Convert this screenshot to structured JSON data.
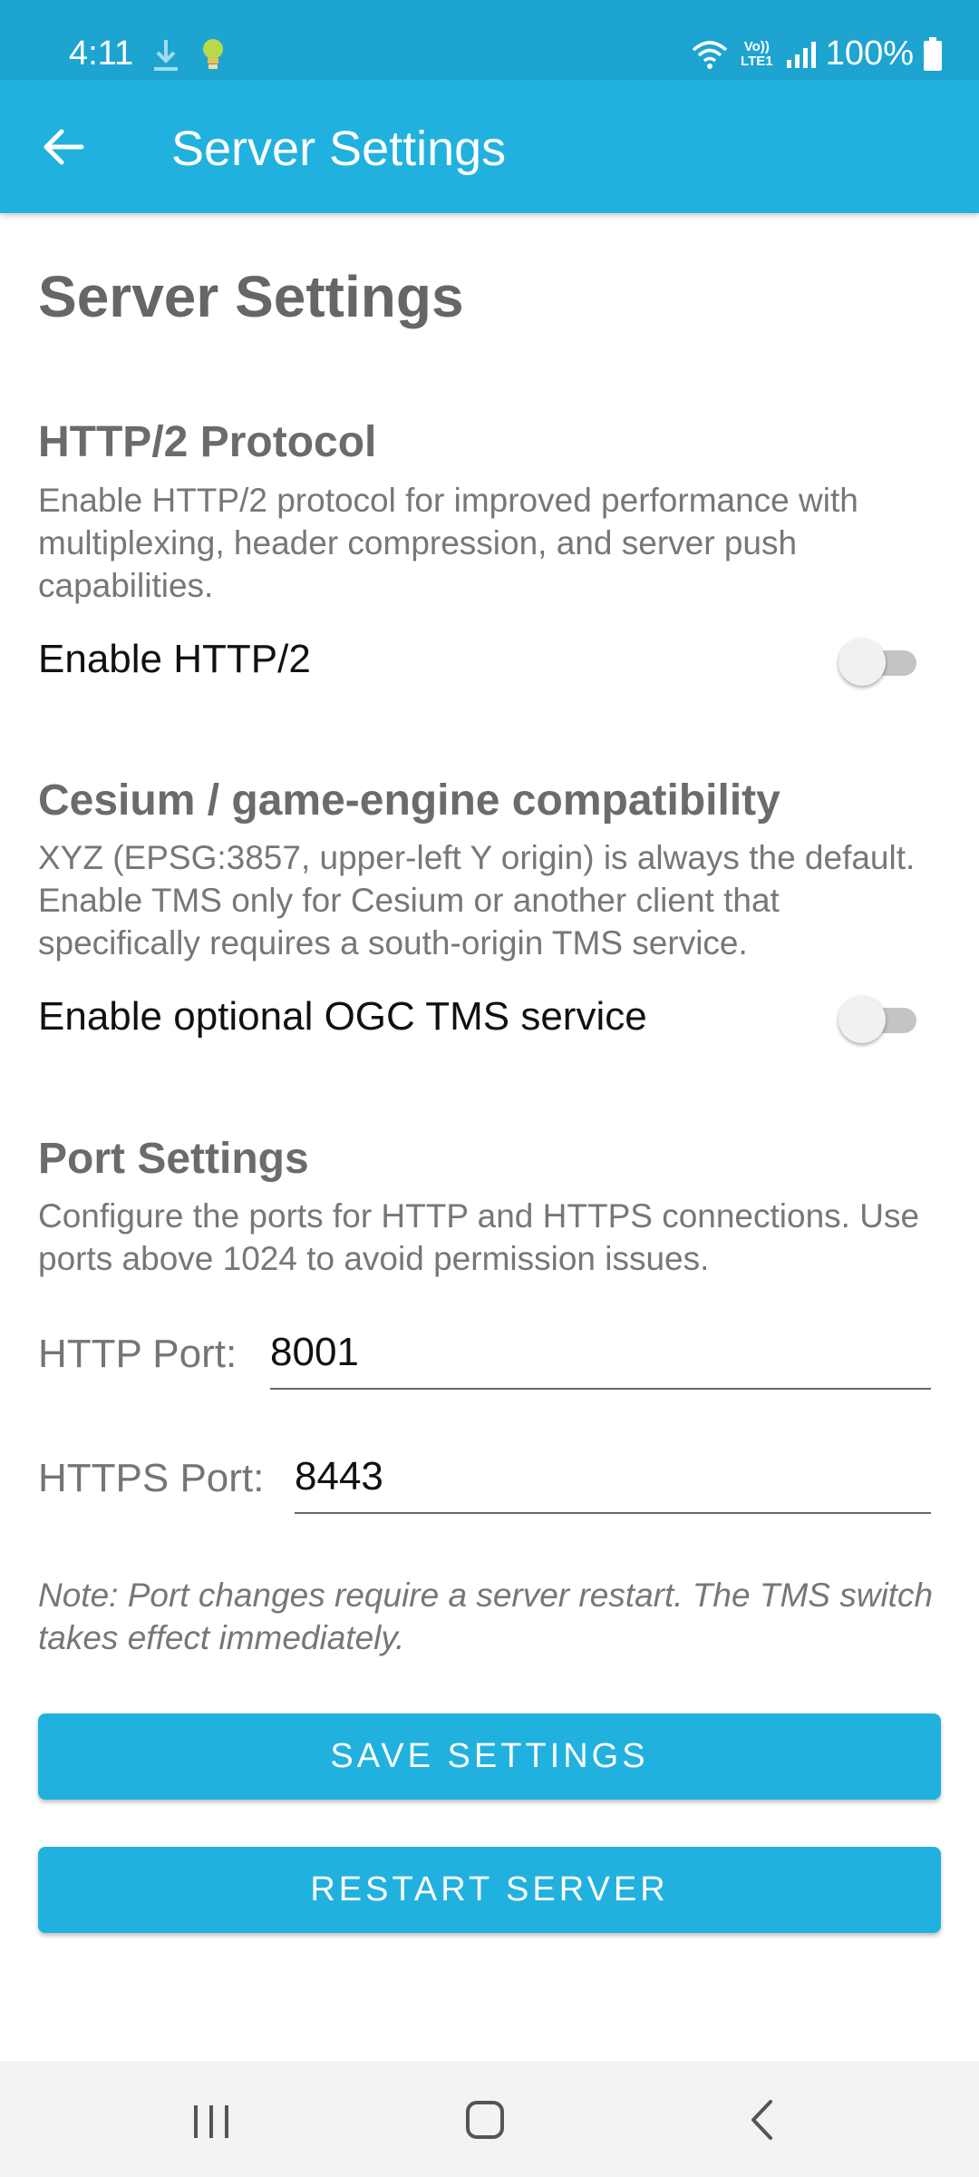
{
  "status_bar": {
    "time": "4:11",
    "network": "Vo)) LTE1",
    "battery": "100%"
  },
  "app_bar": {
    "title": "Server Settings"
  },
  "page": {
    "title": "Server Settings"
  },
  "http2": {
    "title": "HTTP/2 Protocol",
    "description": "Enable HTTP/2 protocol for improved performance with multiplexing, header compression, and server push capabilities.",
    "toggle_label": "Enable HTTP/2",
    "enabled": false
  },
  "cesium": {
    "title": "Cesium / game-engine compatibility",
    "description": "XYZ (EPSG:3857, upper-left Y origin) is always the default. Enable TMS only for Cesium or another client that specifically requires a south-origin TMS service.",
    "toggle_label": "Enable optional OGC TMS service",
    "enabled": false
  },
  "ports": {
    "title": "Port Settings",
    "description": "Configure the ports for HTTP and HTTPS connections. Use ports above 1024 to avoid permission issues.",
    "http_label": "HTTP Port:",
    "http_value": "8001",
    "https_label": "HTTPS Port:",
    "https_value": "8443",
    "note": "Note: Port changes require a server restart. The TMS switch takes effect immediately."
  },
  "buttons": {
    "save": "SAVE SETTINGS",
    "restart": "RESTART SERVER"
  },
  "colors": {
    "accent": "#21b1de",
    "status_bar": "#1ea4d1"
  }
}
